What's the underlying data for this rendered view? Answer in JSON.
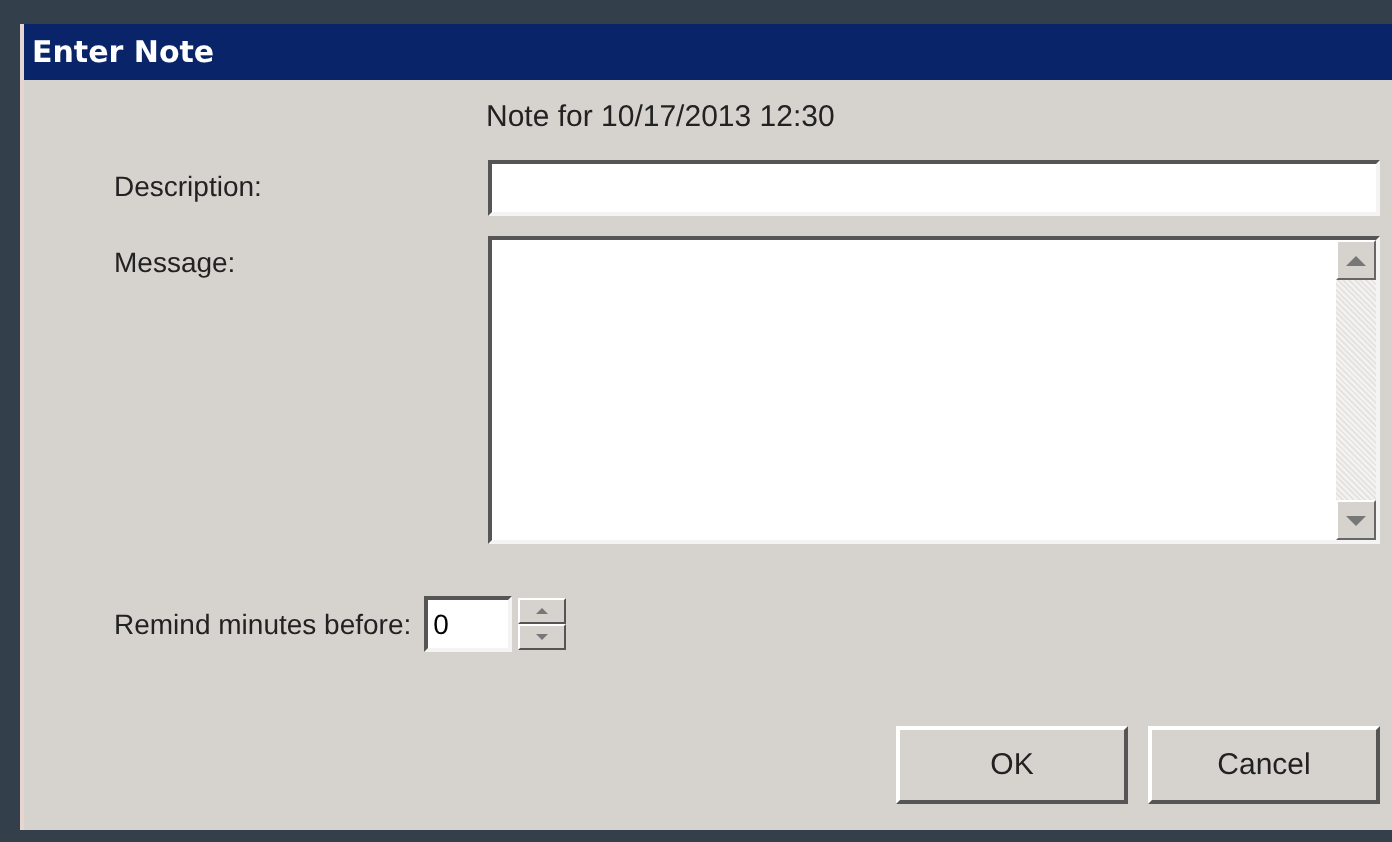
{
  "window": {
    "title": "Enter Note"
  },
  "heading": "Note for 10/17/2013 12:30",
  "fields": [
    {
      "kind": "text",
      "label": "Description:"
    },
    {
      "kind": "multiline",
      "label": "Message:"
    },
    {
      "kind": "spinner",
      "label": "Remind minutes before:",
      "value": "0"
    }
  ],
  "buttons": [
    "OK",
    "Cancel"
  ]
}
